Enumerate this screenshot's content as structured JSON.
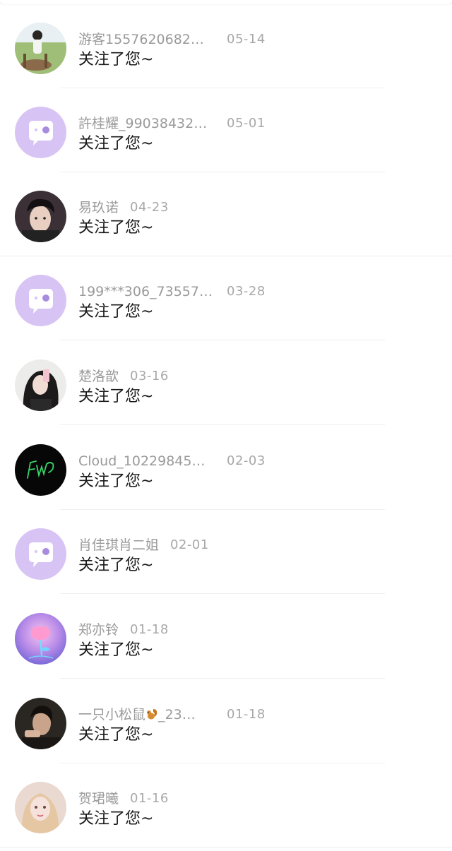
{
  "notifications": [
    {
      "name": "游客1557620682…",
      "time": "05-14",
      "message": "关注了您~",
      "avatar": "photo-person-with-deer-avatar-icon"
    },
    {
      "name": "許桂耀_99038432…",
      "time": "05-01",
      "message": "关注了您~",
      "avatar": "default-chat-bubble-avatar-icon"
    },
    {
      "name": "易玖诺",
      "time": "04-23",
      "message": "关注了您~",
      "avatar": "photo-young-man-avatar-icon"
    },
    {
      "name": "199***306_73557…",
      "time": "03-28",
      "message": "关注了您~",
      "avatar": "default-chat-bubble-avatar-icon"
    },
    {
      "name": "楚洛歆",
      "time": "03-16",
      "message": "关注了您~",
      "avatar": "photo-girl-selfie-avatar-icon"
    },
    {
      "name": "Cloud_10229845…",
      "time": "02-03",
      "message": "关注了您~",
      "avatar": "black-signature-avatar-icon"
    },
    {
      "name": "肖佳琪肖二姐",
      "time": "02-01",
      "message": "关注了您~",
      "avatar": "default-chat-bubble-avatar-icon"
    },
    {
      "name": "郑亦铃",
      "time": "01-18",
      "message": "关注了您~",
      "avatar": "glowing-rose-avatar-icon"
    },
    {
      "name_prefix": "一只小松鼠",
      "name_suffix": "_23…",
      "time": "01-18",
      "message": "关注了您~",
      "avatar": "photo-man-dark-avatar-icon",
      "emoji": "squirrel-icon"
    },
    {
      "name": "贺珺曦",
      "time": "01-16",
      "message": "关注了您~",
      "avatar": "photo-blonde-girl-avatar-icon"
    }
  ],
  "colors": {
    "default_avatar_bg": "#d8c4f4",
    "name_text": "#9a9a9a",
    "time_text": "#a8a8a8",
    "message_text": "#1a1a1a",
    "divider": "#efefef"
  }
}
